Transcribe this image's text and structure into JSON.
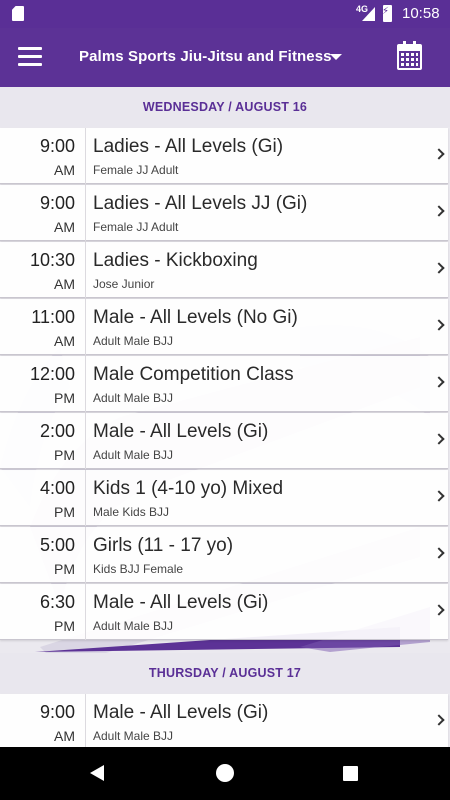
{
  "status_bar": {
    "time": "10:58",
    "network": "4G"
  },
  "app_bar": {
    "title": "Palms Sports Jiu-Jitsu and Fitness"
  },
  "colors": {
    "brand": "#5c3296",
    "accent": "#5a2f96"
  },
  "icons": [
    "sd-card-icon",
    "signal-icon",
    "battery-charging-icon",
    "menu-icon",
    "chevron-down-icon",
    "calendar-icon",
    "chevron-right-icon",
    "back-icon",
    "home-icon",
    "recents-icon"
  ],
  "days": [
    {
      "header": "WEDNESDAY / AUGUST 16",
      "classes": [
        {
          "time": "9:00",
          "ampm": "AM",
          "name": "Ladies - All Levels (Gi)",
          "instructor": "Female JJ Adult"
        },
        {
          "time": "9:00",
          "ampm": "AM",
          "name": "Ladies - All Levels JJ (Gi)",
          "instructor": "Female JJ Adult"
        },
        {
          "time": "10:30",
          "ampm": "AM",
          "name": "Ladies - Kickboxing",
          "instructor": "Jose Junior"
        },
        {
          "time": "11:00",
          "ampm": "AM",
          "name": "Male - All Levels (No Gi)",
          "instructor": "Adult Male BJJ"
        },
        {
          "time": "12:00",
          "ampm": "PM",
          "name": "Male Competition Class",
          "instructor": "Adult Male BJJ"
        },
        {
          "time": "2:00",
          "ampm": "PM",
          "name": "Male - All Levels (Gi)",
          "instructor": "Adult Male BJJ"
        },
        {
          "time": "4:00",
          "ampm": "PM",
          "name": "Kids 1 (4-10 yo) Mixed",
          "instructor": "Male Kids BJJ"
        },
        {
          "time": "5:00",
          "ampm": "PM",
          "name": "Girls (11 - 17 yo)",
          "instructor": "Kids BJJ Female"
        },
        {
          "time": "6:30",
          "ampm": "PM",
          "name": "Male - All Levels (Gi)",
          "instructor": "Adult Male BJJ"
        }
      ]
    },
    {
      "header": "THURSDAY / AUGUST 17",
      "classes": [
        {
          "time": "9:00",
          "ampm": "AM",
          "name": "Male - All Levels (Gi)",
          "instructor": "Adult Male BJJ"
        }
      ]
    }
  ]
}
